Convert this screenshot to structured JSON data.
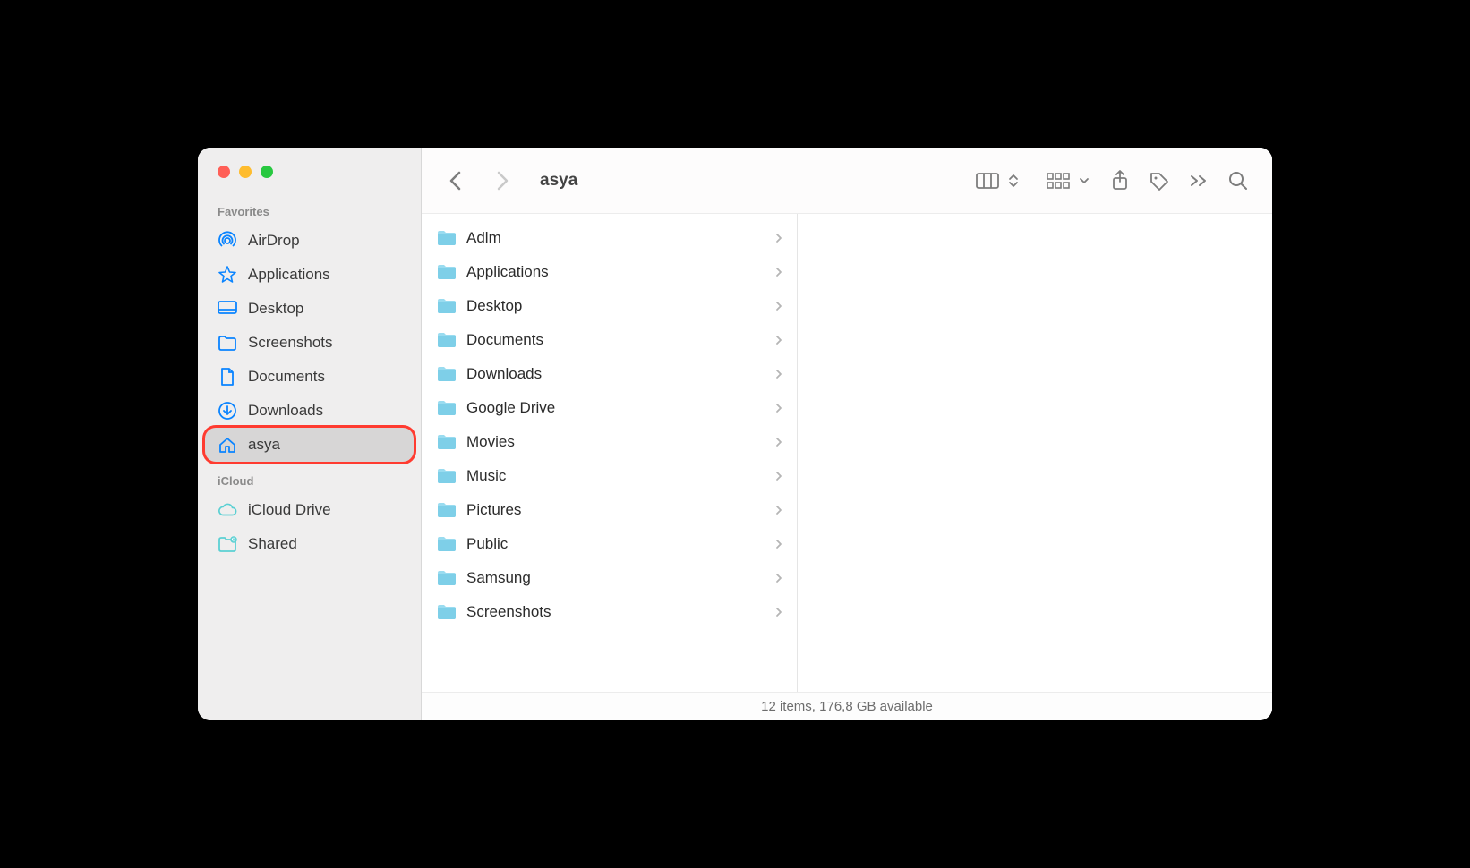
{
  "window_title": "asya",
  "sidebar": {
    "sections": [
      {
        "heading": "Favorites",
        "items": [
          {
            "label": "AirDrop",
            "icon": "airdrop",
            "selected": false,
            "highlighted": false
          },
          {
            "label": "Applications",
            "icon": "apps",
            "selected": false,
            "highlighted": false
          },
          {
            "label": "Desktop",
            "icon": "desktop",
            "selected": false,
            "highlighted": false
          },
          {
            "label": "Screenshots",
            "icon": "folder",
            "selected": false,
            "highlighted": false
          },
          {
            "label": "Documents",
            "icon": "document",
            "selected": false,
            "highlighted": false
          },
          {
            "label": "Downloads",
            "icon": "downloads",
            "selected": false,
            "highlighted": false
          },
          {
            "label": "asya",
            "icon": "home",
            "selected": true,
            "highlighted": true
          }
        ]
      },
      {
        "heading": "iCloud",
        "items": [
          {
            "label": "iCloud Drive",
            "icon": "cloud",
            "selected": false,
            "highlighted": false
          },
          {
            "label": "Shared",
            "icon": "shared-folder",
            "selected": false,
            "highlighted": false
          }
        ]
      }
    ]
  },
  "content": {
    "items": [
      {
        "name": "Adlm"
      },
      {
        "name": "Applications"
      },
      {
        "name": "Desktop"
      },
      {
        "name": "Documents"
      },
      {
        "name": "Downloads"
      },
      {
        "name": "Google Drive"
      },
      {
        "name": "Movies"
      },
      {
        "name": "Music"
      },
      {
        "name": "Pictures"
      },
      {
        "name": "Public"
      },
      {
        "name": "Samsung"
      },
      {
        "name": "Screenshots"
      }
    ]
  },
  "status": "12 items, 176,8 GB available"
}
